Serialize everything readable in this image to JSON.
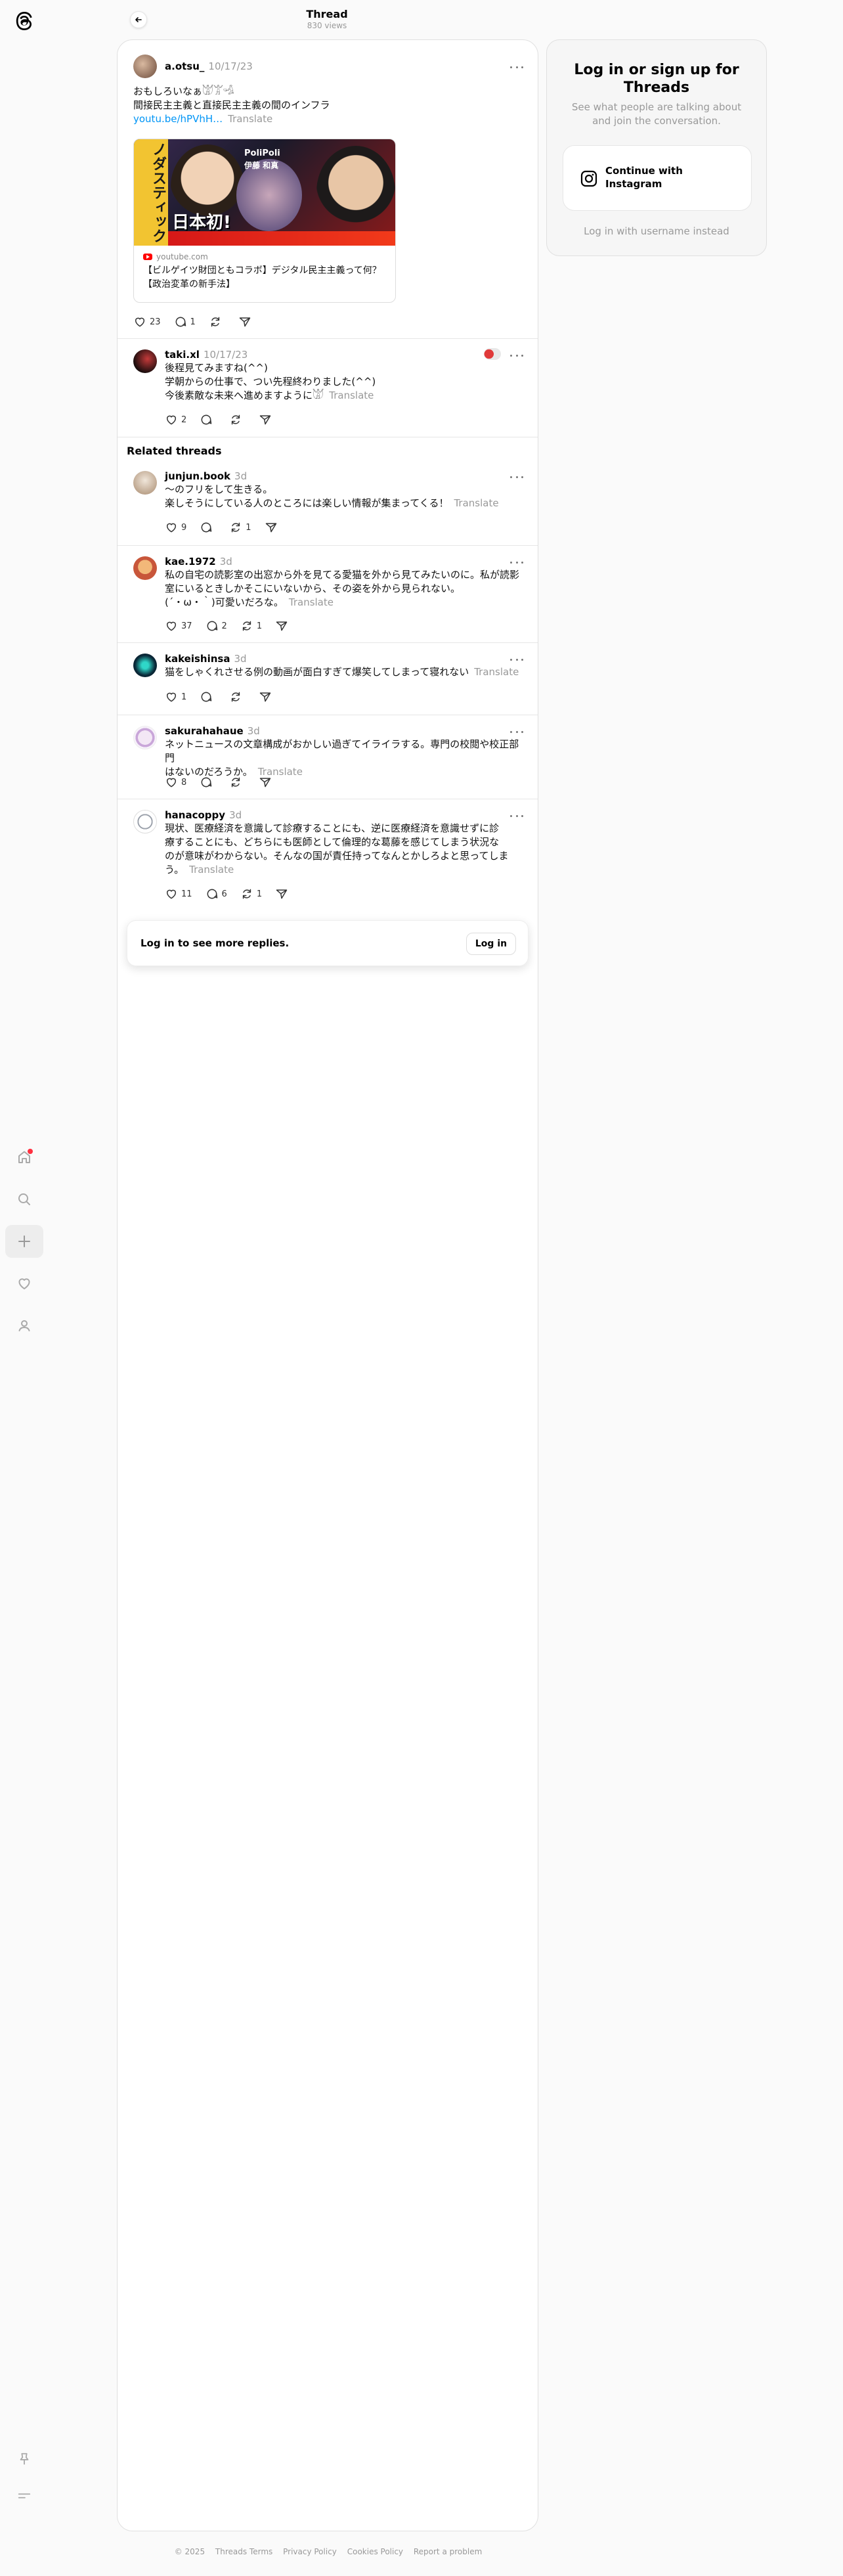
{
  "header": {
    "title": "Thread",
    "views": "830 views"
  },
  "main_post": {
    "username": "a.otsu_",
    "time": "10/17/23",
    "lines": [
      "おもしろいなぁ𓀫𓀠𓁉",
      "間接民主主義と直接民主主義の間のインフラ"
    ],
    "link": "youtu.be/hPVhH…",
    "translate": "Translate",
    "embed": {
      "domain": "youtube.com",
      "title": "【ビルゲイツ財団ともコラボ】デジタル民主主義って何？【政治変革の新手法】",
      "thumb_text_main": "日本初!",
      "thumb_text_side": "ノダスティック",
      "thumb_badge_1": "PoliPoli",
      "thumb_badge_2": "伊藤 和真"
    },
    "likes": "23",
    "replies": "1",
    "reposts": ""
  },
  "reply": {
    "username": "taki.xl",
    "time": "10/17/23",
    "lines": [
      "後程見てみますね(^^)",
      "学朝からの仕事で、つい先程終わりました(^^)",
      "今後素敵な未来へ進めますように𓀫"
    ],
    "translate": "Translate",
    "likes": "2",
    "replies": "",
    "reposts": ""
  },
  "related_title": "Related threads",
  "related": [
    {
      "username": "junjun.book",
      "time": "3d",
      "lines": [
        "〜のフリをして生きる。",
        "楽しそうにしている人のところには楽しい情報が集まってくる！"
      ],
      "translate": "Translate",
      "likes": "9",
      "replies": "",
      "reposts": "1"
    },
    {
      "username": "kae.1972",
      "time": "3d",
      "lines": [
        "私の自宅の読影室の出窓から外を見てる愛猫を外から見てみたいのに。私が読影",
        "室にいるときしかそこにいないから、その姿を外から見られない。",
        "(´・ω・｀)可愛いだろな。"
      ],
      "translate": "Translate",
      "likes": "37",
      "replies": "2",
      "reposts": "1"
    },
    {
      "username": "kakeishinsa",
      "time": "3d",
      "lines": [
        "猫をしゃくれさせる例の動画が面白すぎて爆笑してしまって寝れない"
      ],
      "translate": "Translate",
      "likes": "1",
      "replies": "",
      "reposts": ""
    },
    {
      "username": "sakurahahaue",
      "time": "3d",
      "lines": [
        "ネットニュースの文章構成がおかしい過ぎてイライラする。専門の校閲や校正部門",
        "はないのだろうか。"
      ],
      "translate": "Translate",
      "likes": "8",
      "replies": "",
      "reposts": ""
    },
    {
      "username": "hanacoppy",
      "time": "3d",
      "lines": [
        "現状、医療経済を意識して診療することにも、逆に医療経済を意識せずに診",
        "療することにも、どちらにも医師として倫理的な葛藤を感じてしまう状況な",
        "のが意味がわからない。そんなの国が責任持ってなんとかしろよと思ってしま",
        "う。"
      ],
      "translate": "Translate",
      "likes": "11",
      "replies": "6",
      "reposts": "1"
    }
  ],
  "login_more": {
    "text": "Log in to see more replies.",
    "button": "Log in"
  },
  "side": {
    "heading": "Log in or sign up for Threads",
    "sub": "See what people are talking about and join the conversation.",
    "ig_button": "Continue with Instagram",
    "alt": "Log in with username instead"
  },
  "footer": [
    "© 2025",
    "Threads Terms",
    "Privacy Policy",
    "Cookies Policy",
    "Report a problem"
  ],
  "colors": {
    "link": "#0095f6",
    "notif": "#ff3040",
    "muted": "#999999"
  }
}
